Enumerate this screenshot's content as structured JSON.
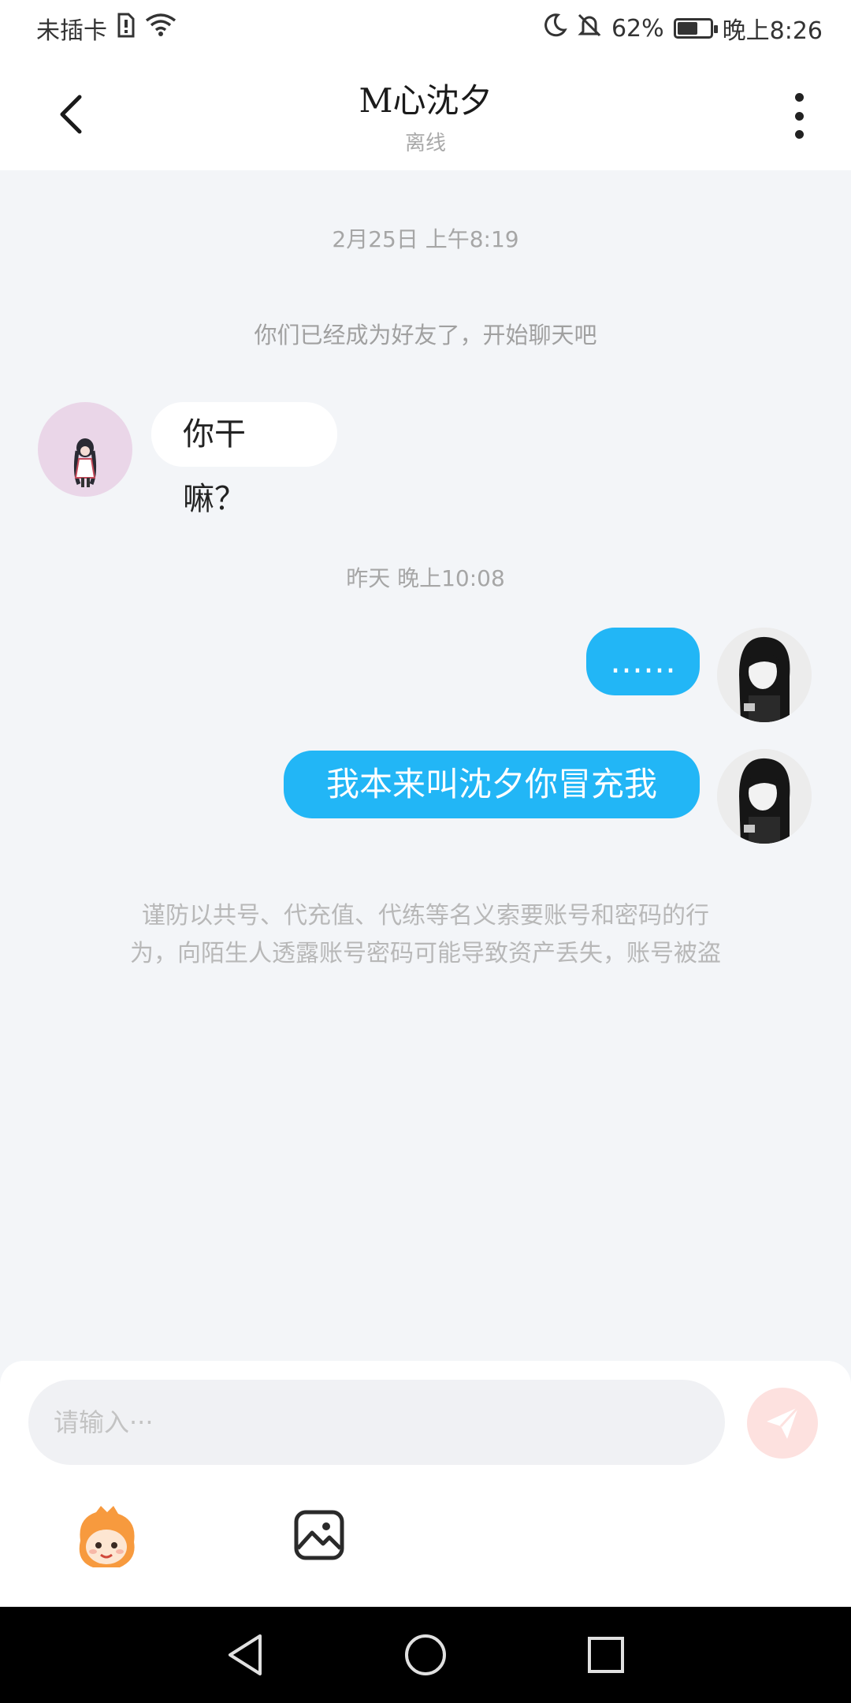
{
  "status_bar": {
    "carrier": "未插卡",
    "battery": "62%",
    "battery_level": 0.62,
    "time": "晚上8:26"
  },
  "header": {
    "title": "M心沈夕",
    "status": "离线"
  },
  "messages": {
    "timestamp_1": "2月25日 上午8:19",
    "system_notice": "你们已经成为好友了，开始聊天吧",
    "incoming_1": "你干嘛？",
    "timestamp_2": "昨天 晚上10:08",
    "outgoing_1": "……",
    "outgoing_2": "我本来叫沈夕你冒充我",
    "warning_line_1": "谨防以共号、代充值、代练等名义索要账号和密码的行",
    "warning_line_2": "为，向陌生人透露账号密码可能导致资产丢失，账号被盗"
  },
  "input": {
    "placeholder": "请输入···"
  },
  "colors": {
    "outgoing_bubble": "#22b6f6",
    "send_button": "#fde1df",
    "nav_bar": "#000000"
  },
  "icons": [
    "chevron-left-icon",
    "more-vertical-icon",
    "send-icon",
    "emoji-mascot-icon",
    "image-icon",
    "nav-back-icon",
    "nav-home-icon",
    "nav-recents-icon"
  ]
}
